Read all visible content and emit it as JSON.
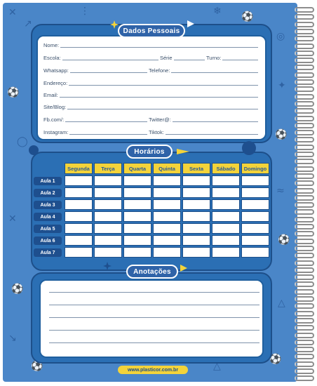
{
  "sections": {
    "personal_title": "Dados Pessoais",
    "schedule_title": "Horários",
    "notes_title": "Anotações"
  },
  "personal_fields": [
    {
      "label": "Nome:"
    },
    {
      "label": "Escola:"
    },
    {
      "label": "Série"
    },
    {
      "label": "Turno:"
    },
    {
      "label": "Whatsapp:"
    },
    {
      "label": "Telefone:"
    },
    {
      "label": "Endereço:"
    },
    {
      "label": "Email:"
    },
    {
      "label": "Site/Blog:"
    },
    {
      "label": "Fb.com/:"
    },
    {
      "label": "Twitter@:"
    },
    {
      "label": "Instagram:"
    },
    {
      "label": "Tiktok:"
    }
  ],
  "schedule": {
    "days": [
      "Segunda",
      "Terça",
      "Quarta",
      "Quinta",
      "Sexta",
      "Sábado",
      "Domingo"
    ],
    "rows": [
      "Aula 1",
      "Aula 2",
      "Aula 3",
      "Aula 4",
      "Aula 5",
      "Aula 6",
      "Aula 7"
    ]
  },
  "footer": {
    "url": "www.plasticor.com.br"
  },
  "colors": {
    "background": "#4a86c8",
    "panel": "#2b6fb4",
    "accent": "#f3d33a",
    "dark": "#1e4f8e"
  },
  "icons": [
    "spiral-binding-icon",
    "soccer-ball-icon",
    "star-icon",
    "triangle-icon"
  ]
}
